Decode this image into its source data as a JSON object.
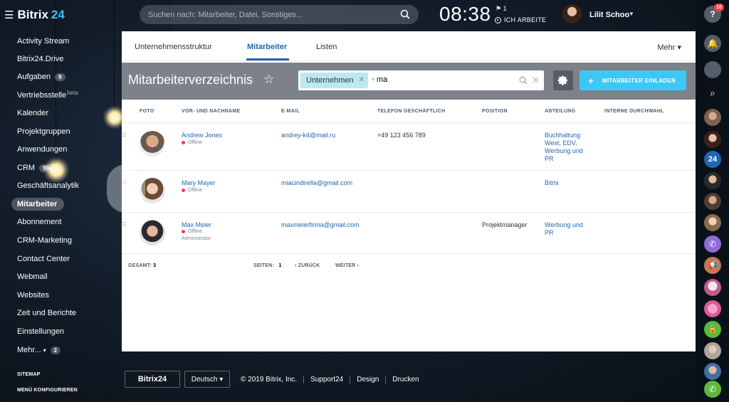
{
  "app": {
    "name": "Bitrix",
    "name_num": "24"
  },
  "search": {
    "placeholder": "Suchen nach: Mitarbeiter, Datei, Sonstiges..."
  },
  "clock": {
    "time": "08:38",
    "flag_count": "1",
    "work_status": "ICH ARBEITE"
  },
  "user": {
    "name": "Lilit Schoo"
  },
  "sidebar": {
    "items": [
      {
        "label": "Activity Stream"
      },
      {
        "label": "Bitrix24.Drive"
      },
      {
        "label": "Aufgaben",
        "badge": "9"
      },
      {
        "label": "Vertriebsstelle",
        "sup": "beta"
      },
      {
        "label": "Kalender"
      },
      {
        "label": "Projektgruppen"
      },
      {
        "label": "Anwendungen"
      },
      {
        "label": "CRM",
        "badge": "99+"
      },
      {
        "label": "Geschäftsanalytik"
      },
      {
        "label": "Mitarbeiter"
      },
      {
        "label": "Abonnement"
      },
      {
        "label": "CRM-Marketing"
      },
      {
        "label": "Contact Center"
      },
      {
        "label": "Webmail"
      },
      {
        "label": "Websites"
      },
      {
        "label": "Zeit und Berichte"
      },
      {
        "label": "Einstellungen"
      },
      {
        "label": "Mehr...",
        "badge": "2"
      }
    ],
    "sitemap": "SITEMAP",
    "configure": "MENÜ KONFIGURIEREN"
  },
  "tabs": [
    {
      "label": "Unternehmensstruktur"
    },
    {
      "label": "Mitarbeiter"
    },
    {
      "label": "Listen"
    }
  ],
  "more_label": "Mehr",
  "page": {
    "title": "Mitarbeiterverzeichnis"
  },
  "filter": {
    "chip": "Unternehmen",
    "text": "ma"
  },
  "invite_label": "MITARBEITER EINLADEN",
  "table": {
    "headers": [
      "FOTO",
      "VOR- UND NACHNAME",
      "E-MAIL",
      "TELEFON GESCHÄFTLICH",
      "POSITION",
      "ABTEILUNG",
      "INTERNE DURCHWAHL"
    ],
    "rows": [
      {
        "name": "Andrew Jones",
        "status": "Offline",
        "role": "",
        "email": "andrey-k4@mail.ru",
        "phone": "+49 123 456 789",
        "position": "",
        "department": [
          "Buchhaltung",
          "West, EDV,",
          "Werbung und",
          "PR"
        ]
      },
      {
        "name": "Mary Mayer",
        "status": "Offline",
        "role": "",
        "email": "miacindirella@gmail.com",
        "phone": "",
        "position": "",
        "department": [
          "Bitrix"
        ]
      },
      {
        "name": "Max Meier",
        "status": "Offline",
        "role": "Administrator",
        "email": "maxmeierfirma@gmail.com",
        "phone": "",
        "position": "Projektmanager",
        "department": [
          "Werbung und",
          "PR"
        ]
      }
    ],
    "total_label": "GESAMT:",
    "total": "3",
    "pages_label": "SEITEN:",
    "page": "1",
    "back": "ZURÜCK",
    "next": "WEITER"
  },
  "footer": {
    "logo": "Bitrix24",
    "language": "Deutsch",
    "copyright": "© 2019 Bitrix, Inc.",
    "links": [
      "Support24",
      "Design",
      "Drucken"
    ]
  },
  "rightbar": {
    "help_badge": "10"
  },
  "colors": {
    "accent": "#2067b0",
    "invite": "#3bc8f5",
    "offline": "#f0424a",
    "brand_num": "#2fc6f6"
  }
}
